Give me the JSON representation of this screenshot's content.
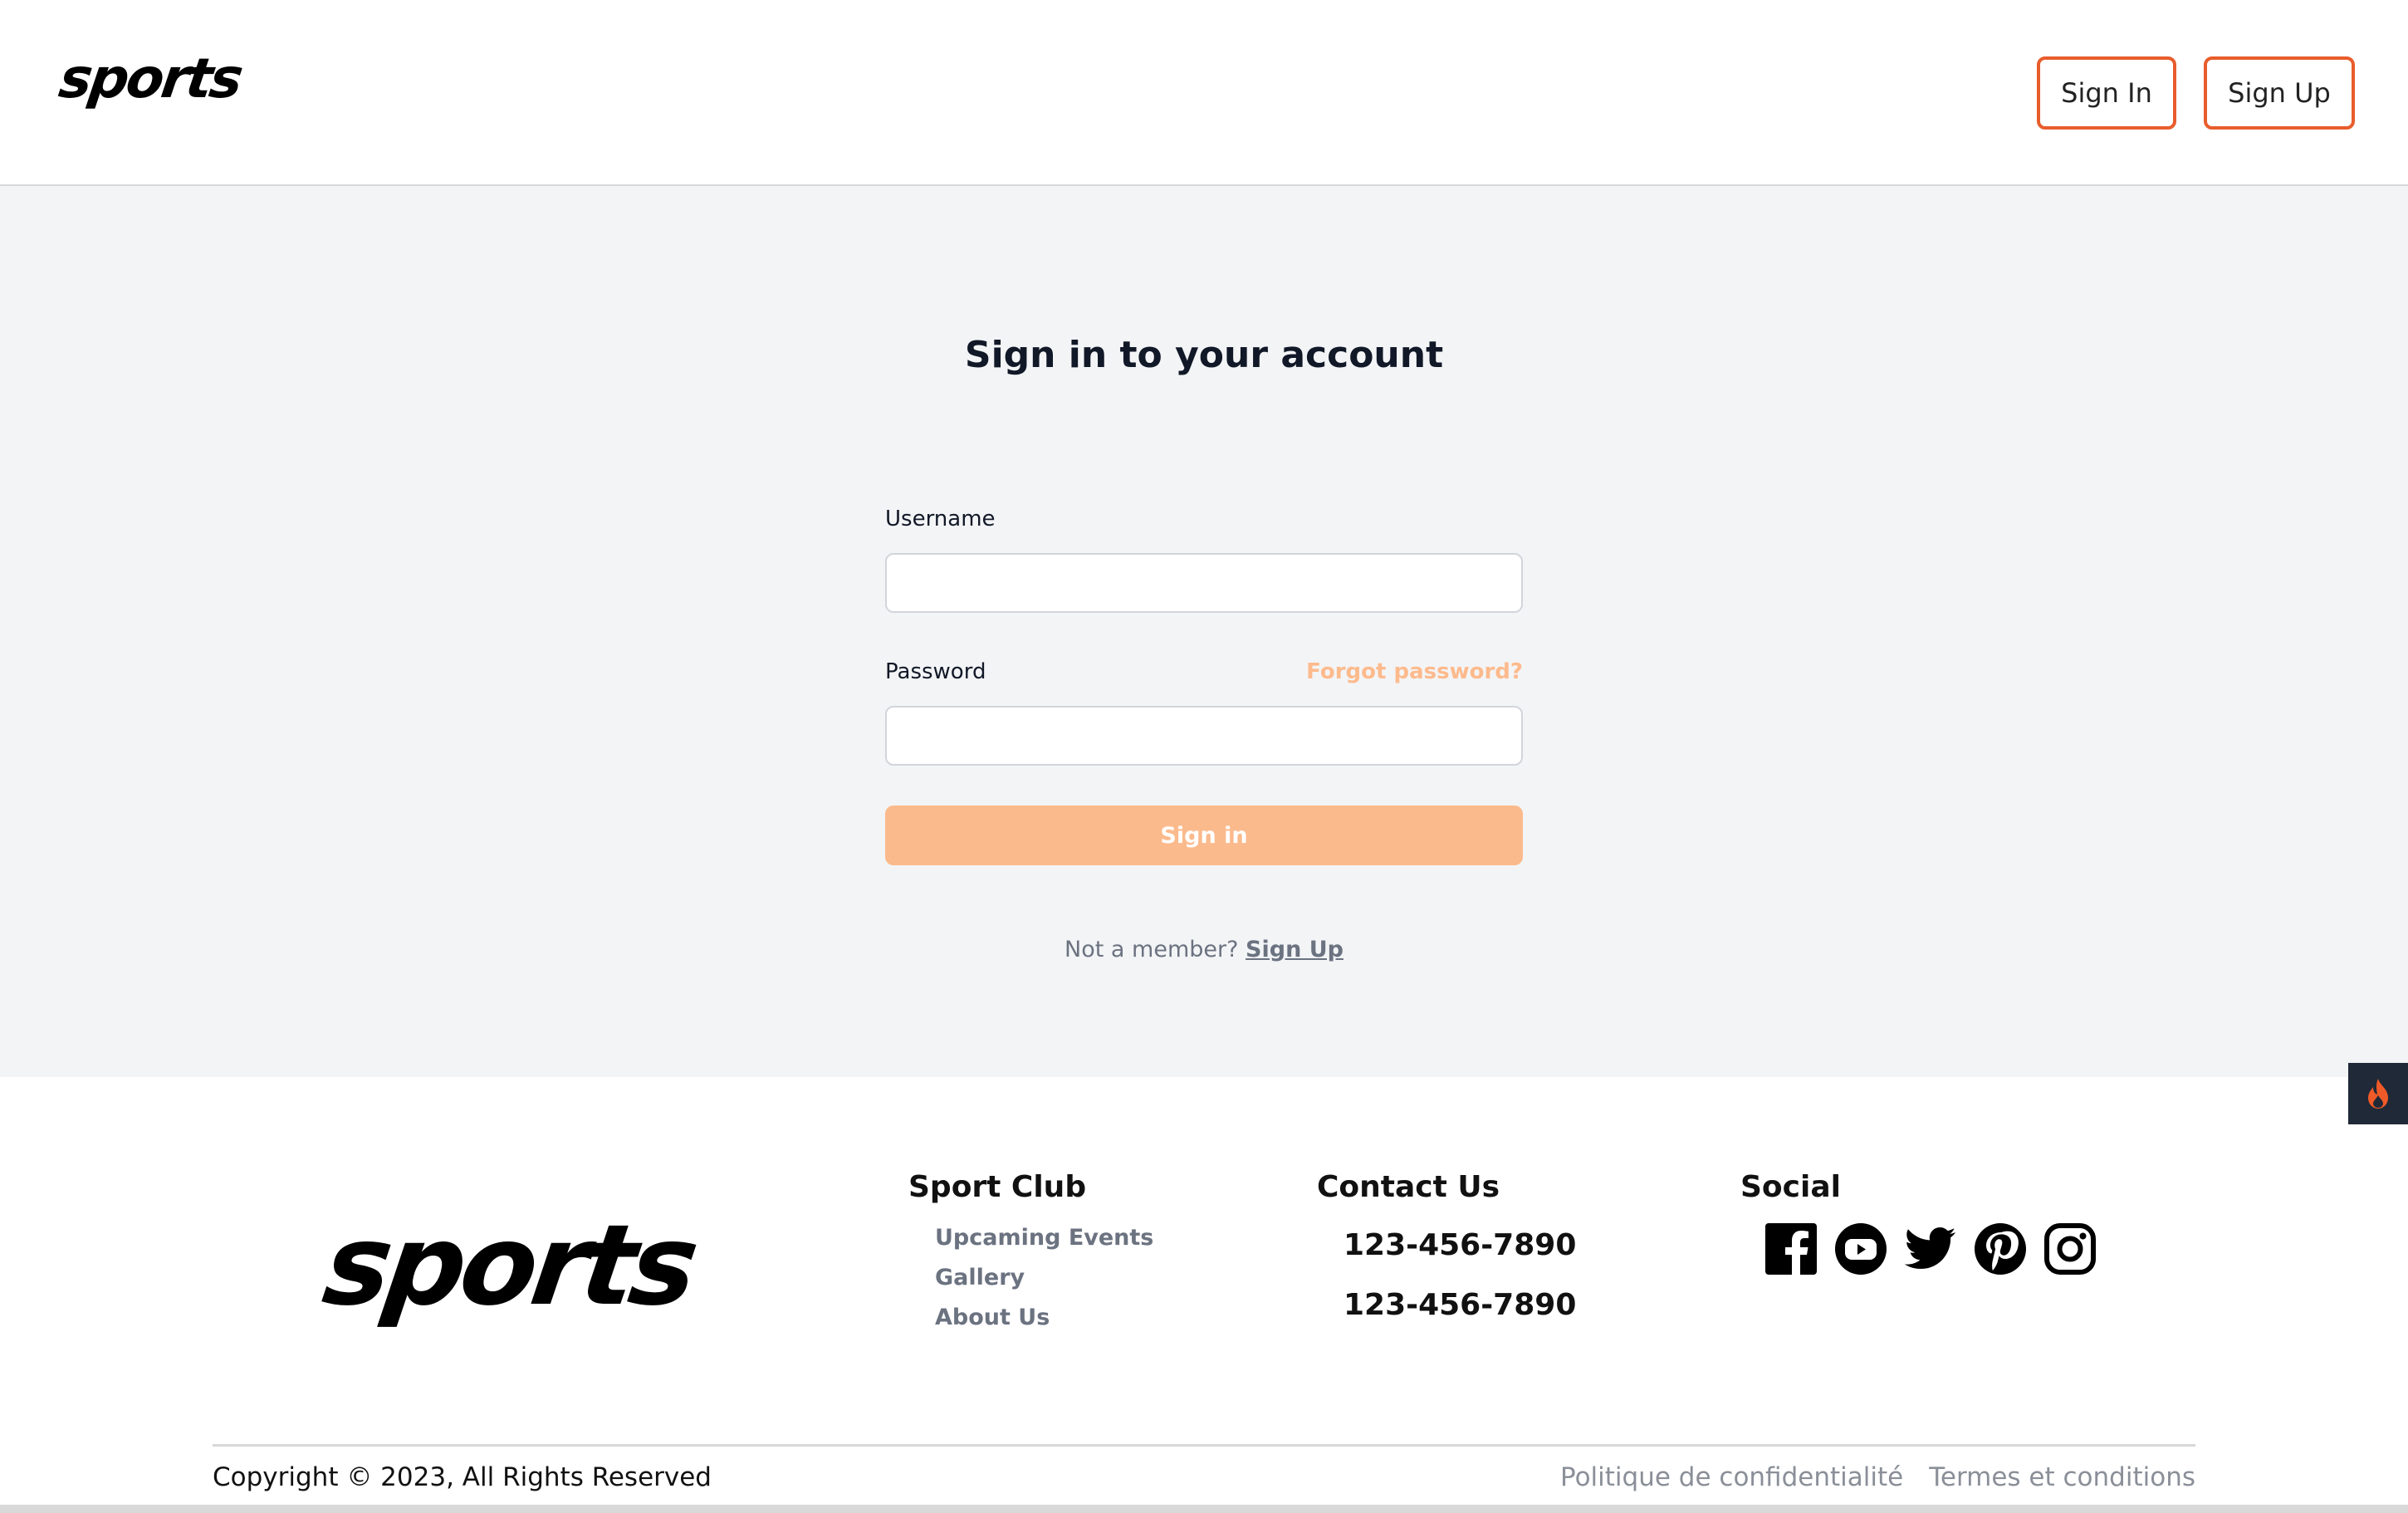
{
  "header": {
    "logo": "sports",
    "sign_in_label": "Sign In",
    "sign_up_label": "Sign Up",
    "accent_color": "#e85d2c"
  },
  "form": {
    "title": "Sign in to your account",
    "username_label": "Username",
    "username_value": "",
    "password_label": "Password",
    "password_value": "",
    "forgot_label": "Forgot password?",
    "submit_label": "Sign in",
    "not_member_text": "Not a member?",
    "sign_up_link": "Sign Up",
    "submit_color": "#fbba8c"
  },
  "side_widget": {
    "icon": "flame-icon"
  },
  "footer": {
    "logo": "sports",
    "sport_club": {
      "title": "Sport Club",
      "links": [
        "Upcaming Events",
        "Gallery",
        "About Us"
      ]
    },
    "contact": {
      "title": "Contact Us",
      "phones": [
        "123-456-7890",
        "123-456-7890"
      ]
    },
    "social": {
      "title": "Social",
      "icons": [
        "facebook-icon",
        "youtube-icon",
        "twitter-icon",
        "pinterest-icon",
        "instagram-icon"
      ]
    },
    "copyright": "Copyright © 2023, All Rights Reserved",
    "privacy": "Politique de confidentialité",
    "terms": "Termes et conditions"
  }
}
